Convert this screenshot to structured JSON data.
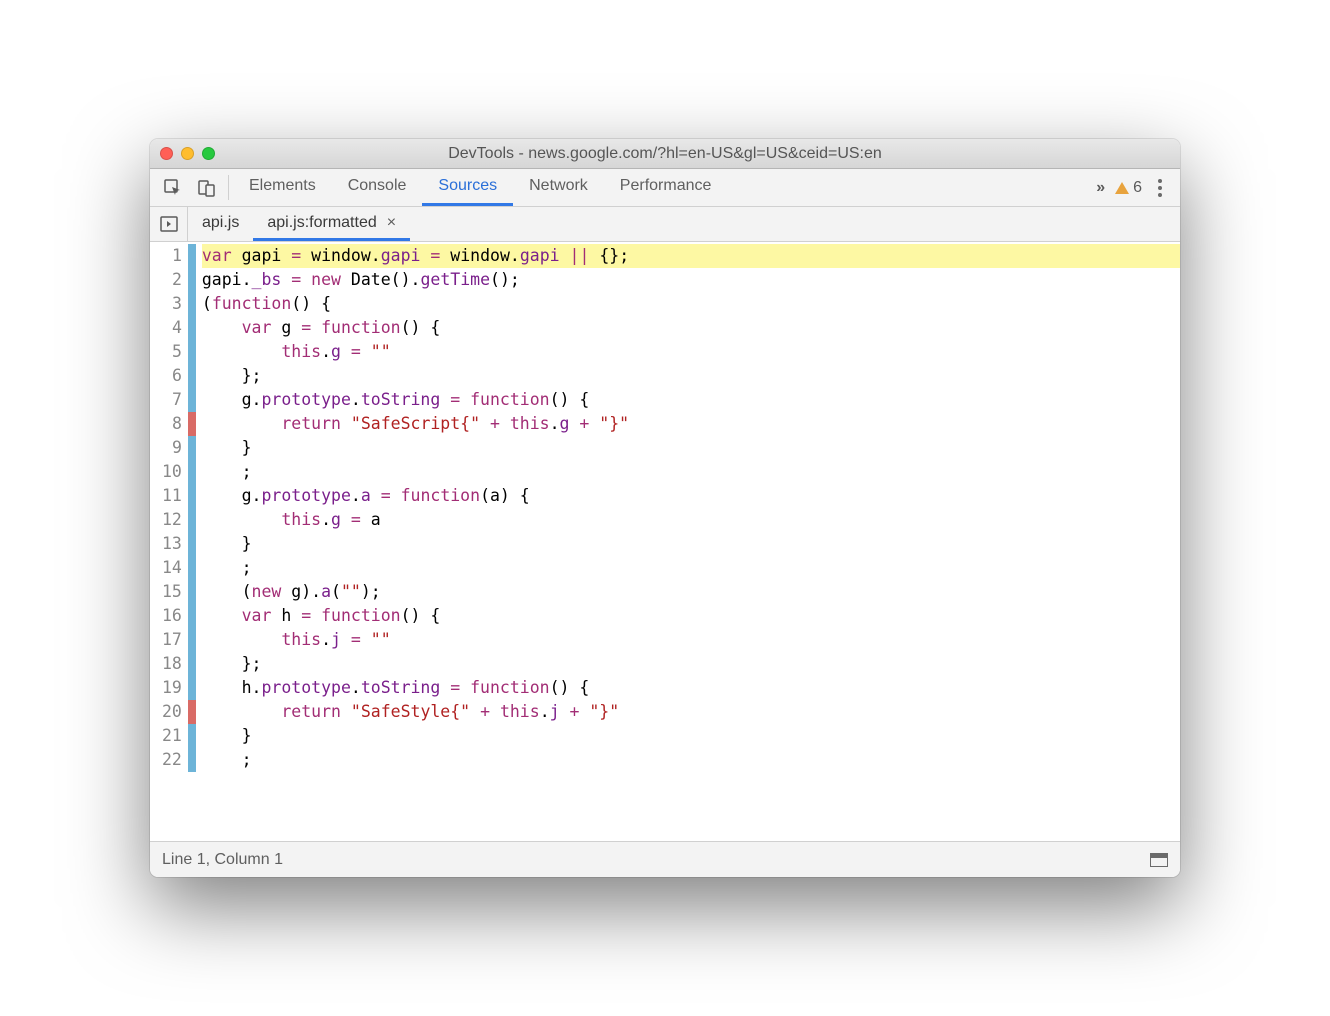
{
  "window": {
    "title": "DevTools - news.google.com/?hl=en-US&gl=US&ceid=US:en"
  },
  "toolbar": {
    "tabs": [
      {
        "label": "Elements",
        "active": false
      },
      {
        "label": "Console",
        "active": false
      },
      {
        "label": "Sources",
        "active": true
      },
      {
        "label": "Network",
        "active": false
      },
      {
        "label": "Performance",
        "active": false
      }
    ],
    "warning_count": "6"
  },
  "filetabs": [
    {
      "label": "api.js",
      "active": false,
      "closable": false
    },
    {
      "label": "api.js:formatted",
      "active": true,
      "closable": true
    }
  ],
  "code": {
    "lines": [
      {
        "n": "1",
        "mark": "blue",
        "hl": true,
        "html": "<span class=\"tok-kw\">var</span> gapi <span class=\"tok-op\">=</span> window.<span class=\"tok-prop\">gapi</span> <span class=\"tok-op\">=</span> window.<span class=\"tok-prop\">gapi</span> <span class=\"tok-op\">||</span> {};"
      },
      {
        "n": "2",
        "mark": "blue",
        "hl": false,
        "html": "gapi.<span class=\"tok-prop\">_bs</span> <span class=\"tok-op\">=</span> <span class=\"tok-kw\">new</span> Date().<span class=\"tok-prop\">getTime</span>();"
      },
      {
        "n": "3",
        "mark": "blue",
        "hl": false,
        "html": "(<span class=\"tok-kw\">function</span>() {"
      },
      {
        "n": "4",
        "mark": "blue",
        "hl": false,
        "html": "    <span class=\"tok-kw\">var</span> g <span class=\"tok-op\">=</span> <span class=\"tok-kw\">function</span>() {"
      },
      {
        "n": "5",
        "mark": "blue",
        "hl": false,
        "html": "        <span class=\"tok-kw\">this</span>.<span class=\"tok-prop\">g</span> <span class=\"tok-op\">=</span> <span class=\"tok-str\">\"\"</span>"
      },
      {
        "n": "6",
        "mark": "blue",
        "hl": false,
        "html": "    };"
      },
      {
        "n": "7",
        "mark": "blue",
        "hl": false,
        "html": "    g.<span class=\"tok-prop\">prototype</span>.<span class=\"tok-prop\">toString</span> <span class=\"tok-op\">=</span> <span class=\"tok-kw\">function</span>() {"
      },
      {
        "n": "8",
        "mark": "red",
        "hl": false,
        "html": "        <span class=\"tok-kw\">return</span> <span class=\"tok-str\">\"SafeScript{\"</span> <span class=\"tok-op\">+</span> <span class=\"tok-kw\">this</span>.<span class=\"tok-prop\">g</span> <span class=\"tok-op\">+</span> <span class=\"tok-str\">\"}\"</span>"
      },
      {
        "n": "9",
        "mark": "blue",
        "hl": false,
        "html": "    }"
      },
      {
        "n": "10",
        "mark": "blue",
        "hl": false,
        "html": "    ;"
      },
      {
        "n": "11",
        "mark": "blue",
        "hl": false,
        "html": "    g.<span class=\"tok-prop\">prototype</span>.<span class=\"tok-prop\">a</span> <span class=\"tok-op\">=</span> <span class=\"tok-kw\">function</span>(a) {"
      },
      {
        "n": "12",
        "mark": "blue",
        "hl": false,
        "html": "        <span class=\"tok-kw\">this</span>.<span class=\"tok-prop\">g</span> <span class=\"tok-op\">=</span> a"
      },
      {
        "n": "13",
        "mark": "blue",
        "hl": false,
        "html": "    }"
      },
      {
        "n": "14",
        "mark": "blue",
        "hl": false,
        "html": "    ;"
      },
      {
        "n": "15",
        "mark": "blue",
        "hl": false,
        "html": "    (<span class=\"tok-kw\">new</span> g).<span class=\"tok-prop\">a</span>(<span class=\"tok-str\">\"\"</span>);"
      },
      {
        "n": "16",
        "mark": "blue",
        "hl": false,
        "html": "    <span class=\"tok-kw\">var</span> h <span class=\"tok-op\">=</span> <span class=\"tok-kw\">function</span>() {"
      },
      {
        "n": "17",
        "mark": "blue",
        "hl": false,
        "html": "        <span class=\"tok-kw\">this</span>.<span class=\"tok-prop\">j</span> <span class=\"tok-op\">=</span> <span class=\"tok-str\">\"\"</span>"
      },
      {
        "n": "18",
        "mark": "blue",
        "hl": false,
        "html": "    };"
      },
      {
        "n": "19",
        "mark": "blue",
        "hl": false,
        "html": "    h.<span class=\"tok-prop\">prototype</span>.<span class=\"tok-prop\">toString</span> <span class=\"tok-op\">=</span> <span class=\"tok-kw\">function</span>() {"
      },
      {
        "n": "20",
        "mark": "red",
        "hl": false,
        "html": "        <span class=\"tok-kw\">return</span> <span class=\"tok-str\">\"SafeStyle{\"</span> <span class=\"tok-op\">+</span> <span class=\"tok-kw\">this</span>.<span class=\"tok-prop\">j</span> <span class=\"tok-op\">+</span> <span class=\"tok-str\">\"}\"</span>"
      },
      {
        "n": "21",
        "mark": "blue",
        "hl": false,
        "html": "    }"
      },
      {
        "n": "22",
        "mark": "blue",
        "hl": false,
        "html": "    ;"
      }
    ]
  },
  "status": {
    "position": "Line 1, Column 1"
  }
}
